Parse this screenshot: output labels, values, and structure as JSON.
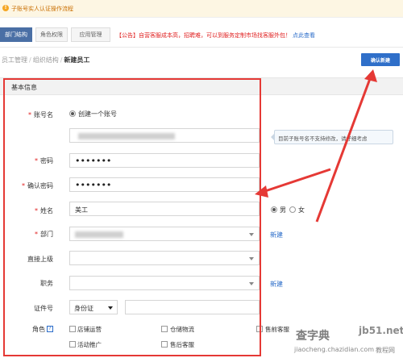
{
  "notice": {
    "text": "子账号实人认证操作流程",
    "icon": "warning-icon"
  },
  "tabs": [
    {
      "label": "部门结构",
      "active": true
    },
    {
      "label": "角色权限",
      "active": false
    },
    {
      "label": "应用管理",
      "active": false
    }
  ],
  "announcement": {
    "text": "【公告】自营客服成本高，招聘难，可以到服务定制市场找客服外包！",
    "link": "点此查看"
  },
  "breadcrumb": {
    "items": [
      "员工管理",
      "组织结构"
    ],
    "current": "新建员工",
    "separator": "/"
  },
  "actions": {
    "confirm_new": "确认新建"
  },
  "section": {
    "title": "基本信息"
  },
  "form": {
    "account_name": {
      "label": "账号名",
      "radio_label": "创建一个账号",
      "tooltip": "目前子账号名不支持修改，请仔细考虑"
    },
    "password": {
      "label": "密码",
      "value": "•••••••"
    },
    "confirm_password": {
      "label": "确认密码",
      "value": "•••••••"
    },
    "name": {
      "label": "姓名",
      "value": "美工",
      "gender_male": "男",
      "gender_female": "女"
    },
    "department": {
      "label": "部门",
      "new_link": "新建"
    },
    "supervisor": {
      "label": "直接上级"
    },
    "position": {
      "label": "职务",
      "new_link": "新建"
    },
    "id_number": {
      "label": "证件号",
      "type_value": "身份证"
    },
    "roles": {
      "label": "角色",
      "options": [
        "店铺运营",
        "仓储物流",
        "售前客服",
        "活动推广",
        "售后客服"
      ]
    }
  },
  "watermark": {
    "line1": "查字典",
    "line1b": "教程网",
    "site": "jb51.net",
    "url": "jiaocheng.chazidian.com"
  },
  "colors": {
    "primary": "#2f6fc9",
    "active_tab": "#4a6fa5",
    "required": "#e02020",
    "annotation_red": "#e53935",
    "notice_text": "#c96e00"
  }
}
